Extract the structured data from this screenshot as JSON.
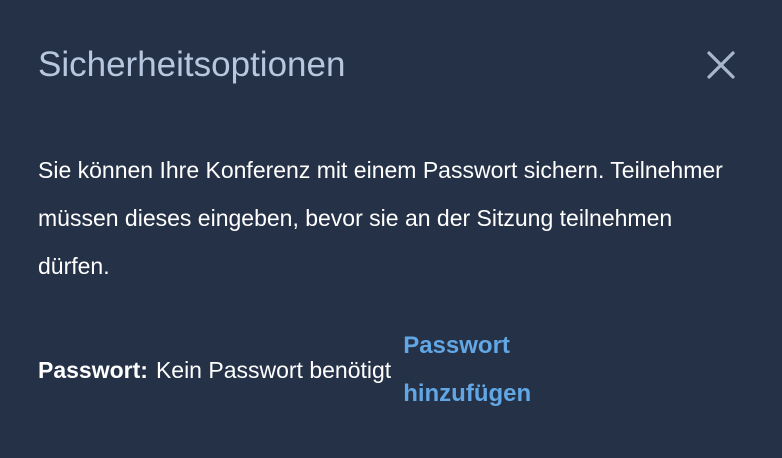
{
  "dialog": {
    "title": "Sicherheitsoptionen",
    "close_icon": "close-icon",
    "description": "Sie können Ihre Konferenz mit einem Passwort sichern. Teilnehmer müssen dieses eingeben, bevor sie an der Sitzung teilnehmen dürfen.",
    "password": {
      "label": "Passwort:",
      "value": "Kein Passwort benötigt",
      "add_link": "Passwort hinzufügen"
    }
  },
  "colors": {
    "background": "#253146",
    "title": "#b8c7e0",
    "text": "#ffffff",
    "link": "#62a6e4",
    "close_icon": "#a8b7cf"
  }
}
